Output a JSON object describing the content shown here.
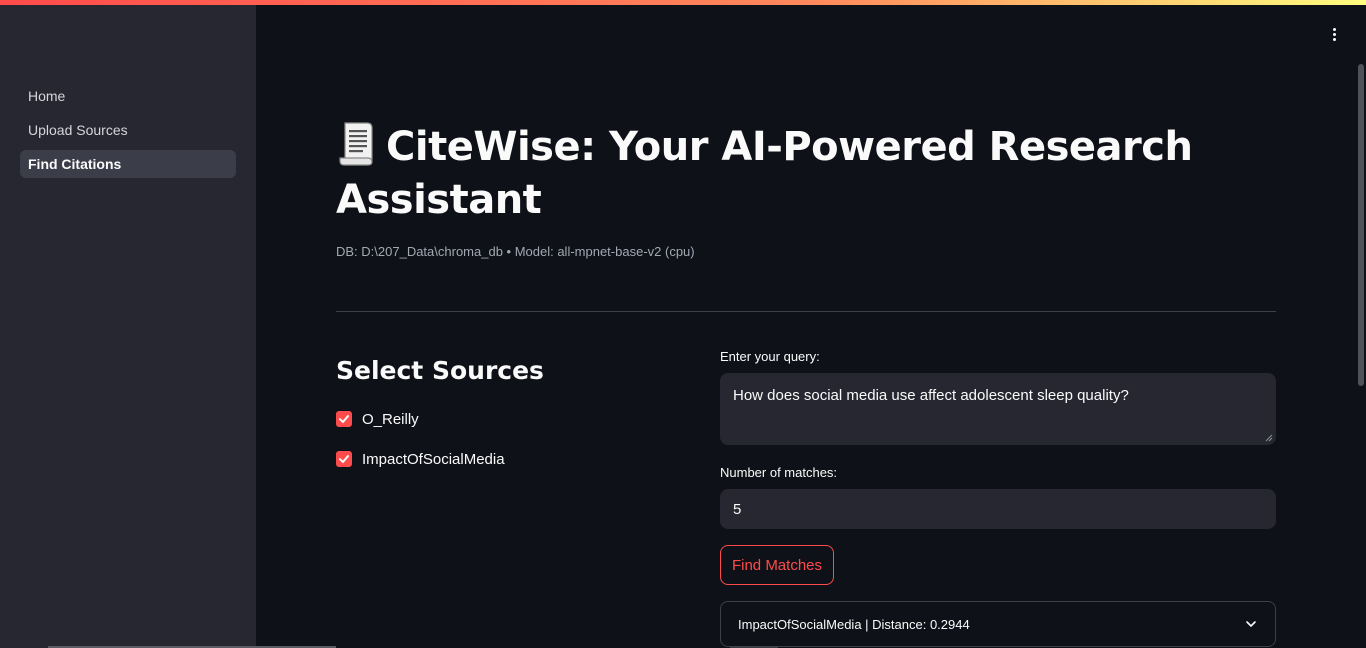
{
  "sidebar": {
    "items": [
      {
        "label": "Home",
        "active": false
      },
      {
        "label": "Upload Sources",
        "active": false
      },
      {
        "label": "Find Citations",
        "active": true
      }
    ]
  },
  "header": {
    "title_line1": "CiteWise: Your AI-Powered Research",
    "title_line2": "Assistant",
    "title_icon": "page-with-curl-icon",
    "caption": "DB: D:\\207_Data\\chroma_db • Model: all-mpnet-base-v2 (cpu)"
  },
  "sources": {
    "title": "Select Sources",
    "options": [
      {
        "label": "O_Reilly",
        "checked": true
      },
      {
        "label": "ImpactOfSocialMedia",
        "checked": true
      }
    ]
  },
  "query": {
    "label": "Enter your query:",
    "value": "How does social media use affect adolescent sleep quality?"
  },
  "matches": {
    "label": "Number of matches:",
    "value": "5"
  },
  "find_button": {
    "label": "Find Matches"
  },
  "result": {
    "label": "ImpactOfSocialMedia | Distance: 0.2944"
  },
  "colors": {
    "accent": "#ff4b4b",
    "background": "#0e1117",
    "sidebar": "#262730",
    "input": "#262730"
  }
}
